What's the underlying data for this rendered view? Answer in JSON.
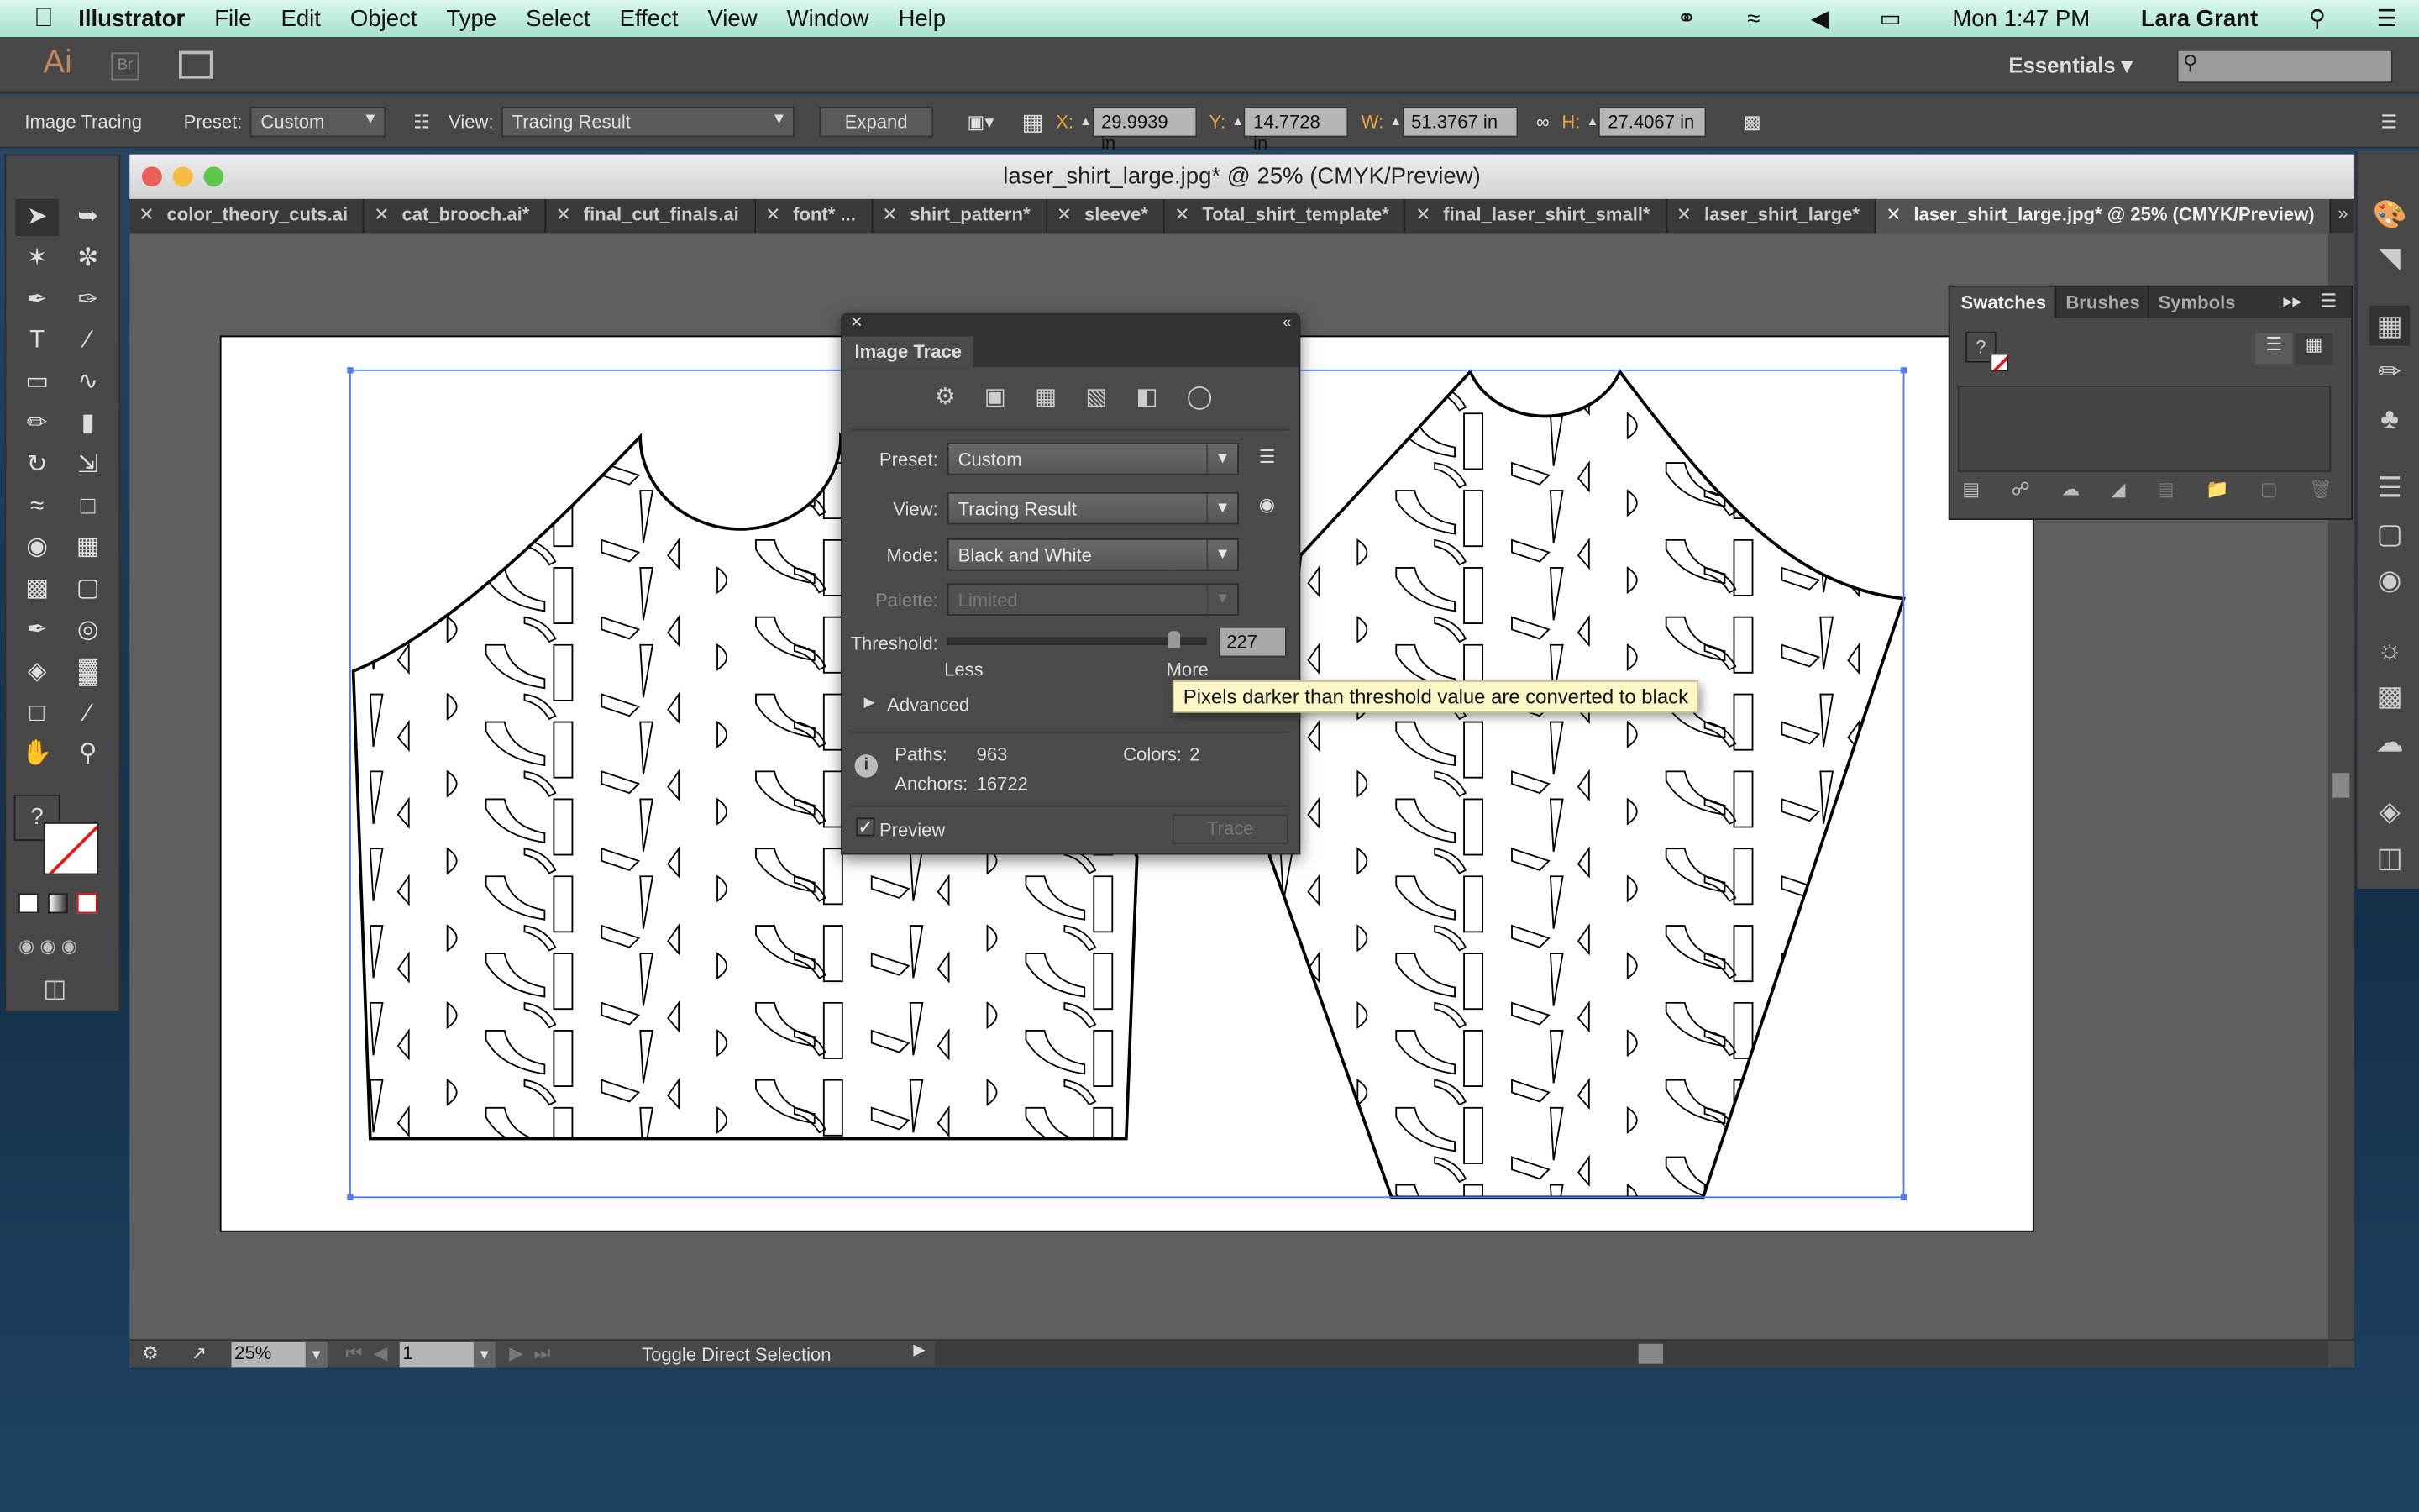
{
  "menubar": {
    "app": "Illustrator",
    "items": [
      "File",
      "Edit",
      "Object",
      "Type",
      "Select",
      "Effect",
      "View",
      "Window",
      "Help"
    ],
    "clock": "Mon 1:47 PM",
    "user": "Lara Grant"
  },
  "appbar": {
    "logo": "Ai",
    "bridge": "Br",
    "workspace": "Essentials",
    "search_placeholder": ""
  },
  "control": {
    "context": "Image Tracing",
    "preset_label": "Preset:",
    "preset": "Custom",
    "view_label": "View:",
    "view": "Tracing Result",
    "expand": "Expand",
    "x_label": "X:",
    "x": "29.9939 in",
    "y_label": "Y:",
    "y": "14.7728 in",
    "w_label": "W:",
    "w": "51.3767 in",
    "h_label": "H:",
    "h": "27.4067 in"
  },
  "document": {
    "title": "laser_shirt_large.jpg* @ 25% (CMYK/Preview)",
    "tabs": [
      {
        "label": "color_theory_cuts.ai"
      },
      {
        "label": "cat_brooch.ai*"
      },
      {
        "label": "final_cut_finals.ai"
      },
      {
        "label": "font* ..."
      },
      {
        "label": "shirt_pattern*"
      },
      {
        "label": "sleeve*"
      },
      {
        "label": "Total_shirt_template*"
      },
      {
        "label": "final_laser_shirt_small*"
      },
      {
        "label": "laser_shirt_large*"
      },
      {
        "label": "laser_shirt_large.jpg* @ 25% (CMYK/Preview)",
        "active": true
      }
    ],
    "zoom": "25%",
    "artboard": "1",
    "status": "Toggle Direct Selection"
  },
  "image_trace": {
    "title": "Image Trace",
    "preset_label": "Preset:",
    "preset": "Custom",
    "view_label": "View:",
    "view": "Tracing Result",
    "mode_label": "Mode:",
    "mode": "Black and White",
    "palette_label": "Palette:",
    "palette": "Limited",
    "threshold_label": "Threshold:",
    "threshold": "227",
    "threshold_max": 255,
    "less": "Less",
    "more": "More",
    "advanced": "Advanced",
    "paths_label": "Paths:",
    "paths": "963",
    "colors_label": "Colors:",
    "colors": "2",
    "anchors_label": "Anchors:",
    "anchors": "16722",
    "preview": "Preview",
    "preview_checked": true,
    "trace": "Trace",
    "tooltip": "Pixels darker than threshold value are converted to black"
  },
  "swatches": {
    "tabs": [
      "Swatches",
      "Brushes",
      "Symbols"
    ],
    "swatch": "?"
  },
  "colors": {
    "selection": "#4f7ef0",
    "menubar": "#b8ecd8",
    "panel": "#484848",
    "canvas": "#5f5f5f"
  }
}
